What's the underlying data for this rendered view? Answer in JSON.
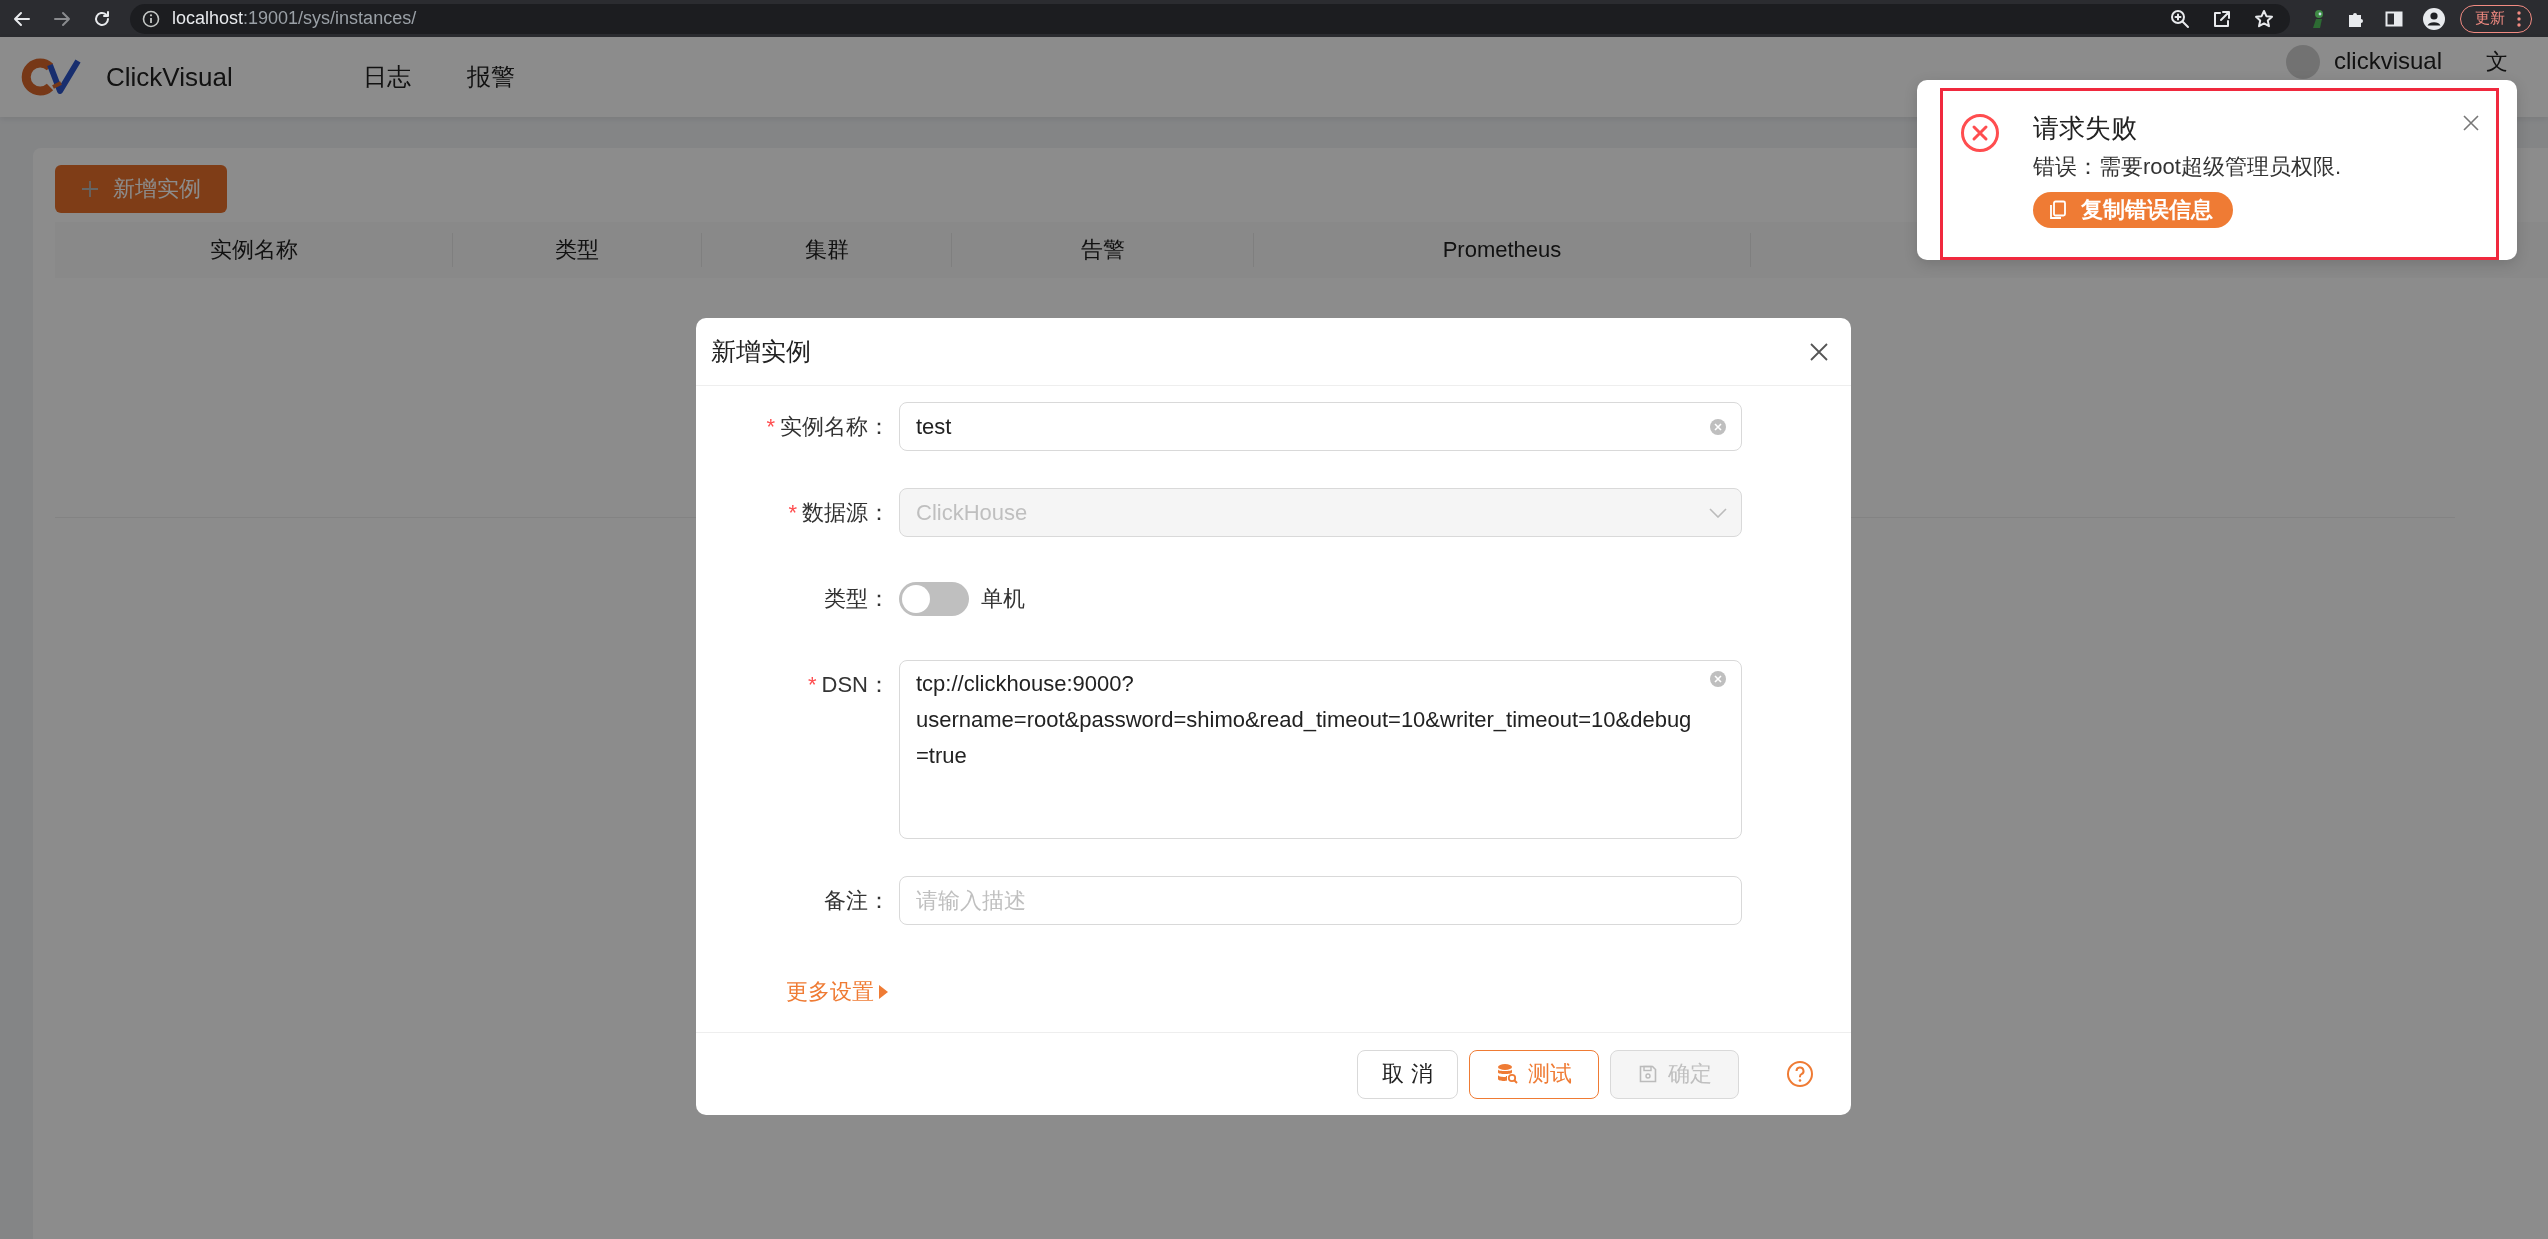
{
  "browser": {
    "url_host": "localhost",
    "url_path": ":19001/sys/instances/",
    "update_label": "更新"
  },
  "header": {
    "brand": "ClickVisual",
    "nav": [
      {
        "label": "日志"
      },
      {
        "label": "报警"
      }
    ],
    "user": "clickvisual",
    "language_icon": "文"
  },
  "page": {
    "add_button": "新增实例",
    "table": {
      "columns": [
        "实例名称",
        "类型",
        "集群",
        "告警",
        "Prometheus"
      ]
    }
  },
  "modal": {
    "title": "新增实例",
    "fields": [
      {
        "kind": "input",
        "required_mark": "*",
        "label": "实例名称：",
        "value": "test",
        "clearable": true
      },
      {
        "kind": "select",
        "required_mark": "*",
        "label": "数据源：",
        "value": "ClickHouse",
        "disabled": true
      },
      {
        "kind": "switch",
        "label": "类型：",
        "on": false,
        "text": "单机"
      },
      {
        "kind": "textarea",
        "required_mark": "*",
        "label": "DSN：",
        "lines": [
          "tcp://clickhouse:9000?",
          "username=root&password=shimo&read_timeout=10&writer_timeout=10&debug",
          "=true"
        ],
        "clearable": true
      },
      {
        "kind": "input",
        "label": "备注：",
        "placeholder": "请输入描述",
        "clearable": false
      }
    ],
    "more_settings": "更多设置",
    "buttons": [
      {
        "kind": "default",
        "label": "取 消",
        "disabled": false
      },
      {
        "kind": "test",
        "label": "测试",
        "disabled": false
      },
      {
        "kind": "save",
        "label": "确定",
        "disabled": true
      }
    ]
  },
  "notification": {
    "title": "请求失败",
    "message": "错误：需要root超级管理员权限.",
    "copy_button": "复制错误信息",
    "highlighted": true
  }
}
